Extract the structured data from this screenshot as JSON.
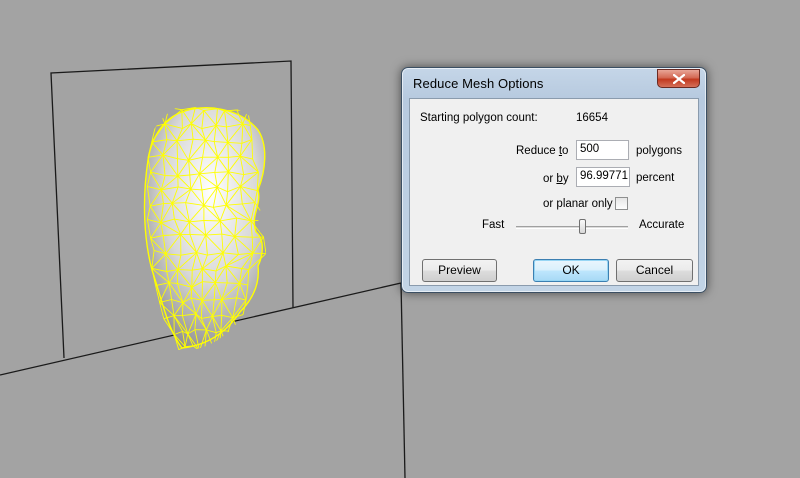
{
  "dialog": {
    "title": "Reduce Mesh Options",
    "starting_label": "Starting polygon count:",
    "starting_value": "16654",
    "reduce_prefix": "Reduce ",
    "reduce_accel": "t",
    "reduce_suffix": "o",
    "reduce_value": "500",
    "reduce_unit": "polygons",
    "orby_prefix": "or ",
    "orby_accel": "b",
    "orby_suffix": "y",
    "orby_value": "96.99771",
    "orby_unit": "percent",
    "planar_label": "or planar only",
    "planar_checked": false,
    "slider_left_label": "Fast",
    "slider_right_label": "Accurate",
    "slider_level": 0.59,
    "preview_label": "Preview",
    "ok_label": "OK",
    "cancel_label": "Cancel"
  },
  "colors": {
    "viewport_background": "#a3a3a3",
    "wireframe": "#ffff00",
    "frame_lines": "#1a1a1a"
  }
}
